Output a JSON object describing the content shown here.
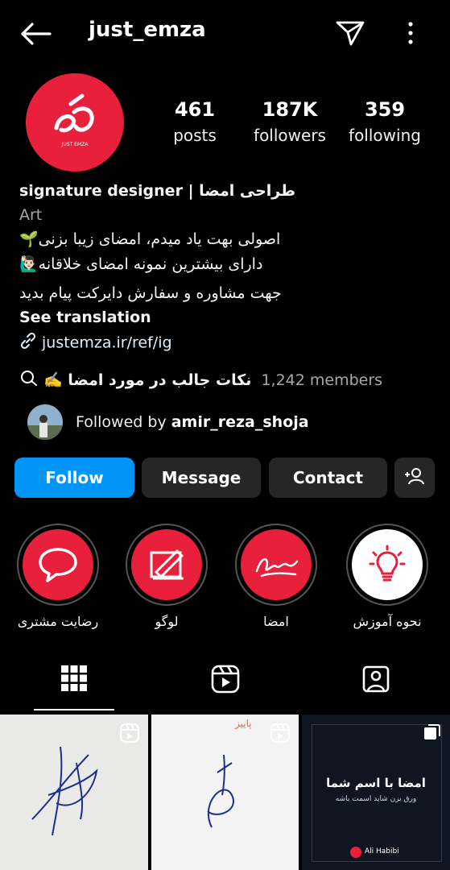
{
  "header": {
    "username": "just_emza"
  },
  "profile": {
    "avatar_text": "JUST EMZA",
    "stats": [
      {
        "value": "461",
        "label": "posts"
      },
      {
        "value": "187K",
        "label": "followers"
      },
      {
        "value": "359",
        "label": "following"
      }
    ],
    "bio_name": "طراحی امضا | signature designer",
    "category": "Art",
    "bio_lines": [
      "اصولی بهت یاد میدم، امضای زیبا بزنی🌱",
      "دارای بیشترین نمونه امضای خلاقانه🙋🏻‍♂️",
      "جهت مشاوره و سفارش دایرکت پیام بدید"
    ],
    "see_translation": "See translation",
    "link": "justemza.ir/ref/ig",
    "channel_name": "نکات جالب در مورد امضا ✍️",
    "channel_members": "1,242 members",
    "followed_by_prefix": "Followed by ",
    "followed_by_user": "amir_reza_shoja"
  },
  "actions": {
    "follow": "Follow",
    "message": "Message",
    "contact": "Contact"
  },
  "highlights": [
    {
      "label": "رضایت مشتری",
      "icon": "speech-bubble-icon"
    },
    {
      "label": "لوگو",
      "icon": "design-tools-icon"
    },
    {
      "label": "امضا",
      "icon": "signature-icon"
    },
    {
      "label": "نحوه آموزش",
      "icon": "lightbulb-icon"
    }
  ],
  "grid_tiles": [
    {
      "caption": "",
      "type": "reel"
    },
    {
      "caption": "پاییز",
      "type": "reel"
    },
    {
      "caption": "امضا با اسم شما",
      "subcaption": "ورق بزن شاید اسمت باشه",
      "footer": "Ali Habibi",
      "type": "carousel"
    }
  ],
  "colors": {
    "accent": "#0095f6",
    "brand_red": "#e8203b",
    "background": "#000000",
    "button_dark": "#262626"
  }
}
